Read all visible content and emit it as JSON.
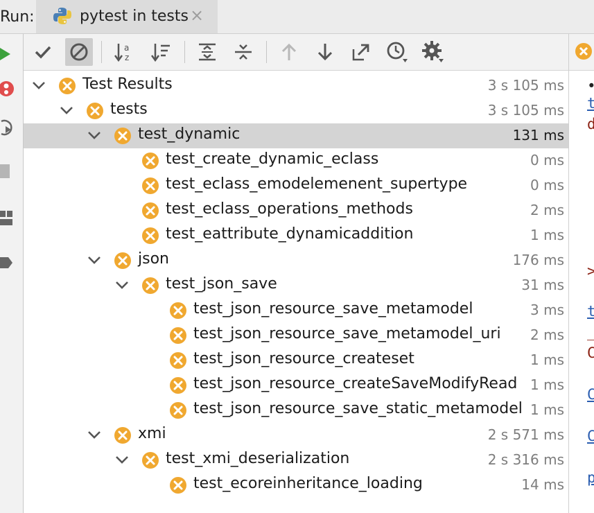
{
  "run_label": "Run:",
  "tab": {
    "title": "pytest in tests"
  },
  "toolbar": {
    "buttons": [
      "show-passed",
      "show-ignored",
      "sort-alphabetically",
      "sort-by-duration",
      "expand-all",
      "collapse-all",
      "previous-failed",
      "next-failed",
      "export",
      "test-history",
      "settings"
    ]
  },
  "colors": {
    "fail_icon": "#f0a830",
    "selection": "#d4d4d4",
    "run_green": "#3da13d",
    "rerun_red": "#e04d4d"
  },
  "tree": [
    {
      "label": "Test Results",
      "time": "3 s 105 ms",
      "depth": 0,
      "expanded": true
    },
    {
      "label": "tests",
      "time": "3 s 105 ms",
      "depth": 1,
      "expanded": true
    },
    {
      "label": "test_dynamic",
      "time": "131 ms",
      "depth": 2,
      "expanded": true,
      "selected": true
    },
    {
      "label": "test_create_dynamic_eclass",
      "time": "0 ms",
      "depth": 3
    },
    {
      "label": "test_eclass_emodelemenent_supertype",
      "time": "0 ms",
      "depth": 3
    },
    {
      "label": "test_eclass_operations_methods",
      "time": "2 ms",
      "depth": 3
    },
    {
      "label": "test_eattribute_dynamicaddition",
      "time": "1 ms",
      "depth": 3
    },
    {
      "label": "json",
      "time": "176 ms",
      "depth": 2,
      "expanded": true
    },
    {
      "label": "test_json_save",
      "time": "31 ms",
      "depth": 3,
      "expanded": true
    },
    {
      "label": "test_json_resource_save_metamodel",
      "time": "3 ms",
      "depth": 4
    },
    {
      "label": "test_json_resource_save_metamodel_uri",
      "time": "2 ms",
      "depth": 4
    },
    {
      "label": "test_json_resource_createset",
      "time": "1 ms",
      "depth": 4
    },
    {
      "label": "test_json_resource_createSaveModifyRead",
      "time": "1 ms",
      "depth": 4
    },
    {
      "label": "test_json_resource_save_static_metamodel",
      "time": "1 ms",
      "depth": 4
    },
    {
      "label": "xmi",
      "time": "2 s 571 ms",
      "depth": 2,
      "expanded": true
    },
    {
      "label": "test_xmi_deserialization",
      "time": "2 s 316 ms",
      "depth": 3,
      "expanded": true
    },
    {
      "label": "test_ecoreinheritance_loading",
      "time": "14 ms",
      "depth": 4
    }
  ],
  "output_fragments": [
    "•",
    "t",
    "d",
    ">",
    "t",
    "_",
    "C",
    "C",
    "C",
    "p"
  ]
}
